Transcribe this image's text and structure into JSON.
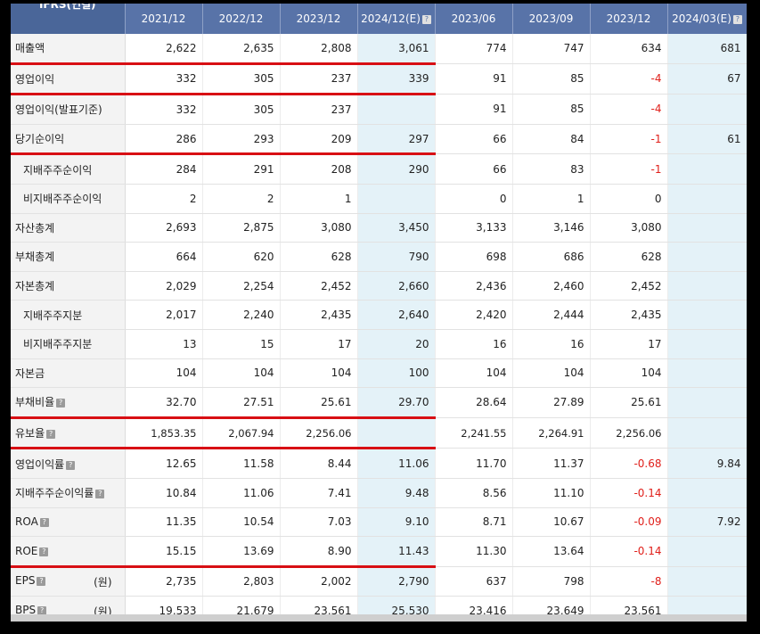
{
  "header": {
    "corner_label": "IFRS(연결)",
    "columns": [
      {
        "label": "2021/12",
        "help": false
      },
      {
        "label": "2022/12",
        "help": false
      },
      {
        "label": "2023/12",
        "help": false
      },
      {
        "label": "2024/12(E)",
        "help": true
      },
      {
        "label": "2023/06",
        "help": false
      },
      {
        "label": "2023/09",
        "help": false
      },
      {
        "label": "2023/12",
        "help": false
      },
      {
        "label": "2024/03(E)",
        "help": true
      }
    ]
  },
  "rows": [
    {
      "label": "매출액",
      "sub": false,
      "help": false,
      "unit": "",
      "red": true,
      "values": [
        "2,622",
        "2,635",
        "2,808",
        "3,061",
        "774",
        "747",
        "634",
        "681"
      ]
    },
    {
      "label": "영업이익",
      "sub": false,
      "help": false,
      "unit": "",
      "red": true,
      "values": [
        "332",
        "305",
        "237",
        "339",
        "91",
        "85",
        "-4",
        "67"
      ]
    },
    {
      "label": "영업이익(발표기준)",
      "sub": false,
      "help": false,
      "unit": "",
      "red": false,
      "values": [
        "332",
        "305",
        "237",
        "",
        "91",
        "85",
        "-4",
        ""
      ]
    },
    {
      "label": "당기순이익",
      "sub": false,
      "help": false,
      "unit": "",
      "red": true,
      "values": [
        "286",
        "293",
        "209",
        "297",
        "66",
        "84",
        "-1",
        "61"
      ]
    },
    {
      "label": "지배주주순이익",
      "sub": true,
      "help": false,
      "unit": "",
      "red": false,
      "values": [
        "284",
        "291",
        "208",
        "290",
        "66",
        "83",
        "-1",
        ""
      ]
    },
    {
      "label": "비지배주주순이익",
      "sub": true,
      "help": false,
      "unit": "",
      "red": false,
      "values": [
        "2",
        "2",
        "1",
        "",
        "0",
        "1",
        "0",
        ""
      ]
    },
    {
      "label": "자산총계",
      "sub": false,
      "help": false,
      "unit": "",
      "red": false,
      "values": [
        "2,693",
        "2,875",
        "3,080",
        "3,450",
        "3,133",
        "3,146",
        "3,080",
        ""
      ]
    },
    {
      "label": "부채총계",
      "sub": false,
      "help": false,
      "unit": "",
      "red": false,
      "values": [
        "664",
        "620",
        "628",
        "790",
        "698",
        "686",
        "628",
        ""
      ]
    },
    {
      "label": "자본총계",
      "sub": false,
      "help": false,
      "unit": "",
      "red": false,
      "values": [
        "2,029",
        "2,254",
        "2,452",
        "2,660",
        "2,436",
        "2,460",
        "2,452",
        ""
      ]
    },
    {
      "label": "지배주주지분",
      "sub": true,
      "help": false,
      "unit": "",
      "red": false,
      "values": [
        "2,017",
        "2,240",
        "2,435",
        "2,640",
        "2,420",
        "2,444",
        "2,435",
        ""
      ]
    },
    {
      "label": "비지배주주지분",
      "sub": true,
      "help": false,
      "unit": "",
      "red": false,
      "values": [
        "13",
        "15",
        "17",
        "20",
        "16",
        "16",
        "17",
        ""
      ]
    },
    {
      "label": "자본금",
      "sub": false,
      "help": false,
      "unit": "",
      "red": false,
      "values": [
        "104",
        "104",
        "104",
        "100",
        "104",
        "104",
        "104",
        ""
      ]
    },
    {
      "label": "부채비율",
      "sub": false,
      "help": true,
      "unit": "",
      "red": true,
      "values": [
        "32.70",
        "27.51",
        "25.61",
        "29.70",
        "28.64",
        "27.89",
        "25.61",
        ""
      ]
    },
    {
      "label": "유보율",
      "sub": false,
      "help": true,
      "unit": "",
      "red": true,
      "values": [
        "1,853.35",
        "2,067.94",
        "2,256.06",
        "",
        "2,241.55",
        "2,264.91",
        "2,256.06",
        ""
      ]
    },
    {
      "label": "영업이익률",
      "sub": false,
      "help": true,
      "unit": "",
      "red": false,
      "values": [
        "12.65",
        "11.58",
        "8.44",
        "11.06",
        "11.70",
        "11.37",
        "-0.68",
        "9.84"
      ]
    },
    {
      "label": "지배주주순이익률",
      "sub": false,
      "help": true,
      "unit": "",
      "red": false,
      "values": [
        "10.84",
        "11.06",
        "7.41",
        "9.48",
        "8.56",
        "11.10",
        "-0.14",
        ""
      ]
    },
    {
      "label": "ROA",
      "sub": false,
      "help": true,
      "unit": "",
      "red": false,
      "values": [
        "11.35",
        "10.54",
        "7.03",
        "9.10",
        "8.71",
        "10.67",
        "-0.09",
        "7.92"
      ]
    },
    {
      "label": "ROE",
      "sub": false,
      "help": true,
      "unit": "",
      "red": true,
      "values": [
        "15.15",
        "13.69",
        "8.90",
        "11.43",
        "11.30",
        "13.64",
        "-0.14",
        ""
      ]
    },
    {
      "label": "EPS",
      "sub": false,
      "help": true,
      "unit": "(원)",
      "red": false,
      "values": [
        "2,735",
        "2,803",
        "2,002",
        "2,790",
        "637",
        "798",
        "-8",
        ""
      ]
    },
    {
      "label": "BPS",
      "sub": false,
      "help": true,
      "unit": "(원)",
      "red": false,
      "values": [
        "19,533",
        "21,679",
        "23,561",
        "25,530",
        "23,416",
        "23,649",
        "23,561",
        ""
      ]
    }
  ],
  "colors": {
    "header_bg": "#5873a8",
    "estimate_bg": "#e4f2f8",
    "negative_text": "#e0201b",
    "highlight_line": "#d80f14"
  }
}
